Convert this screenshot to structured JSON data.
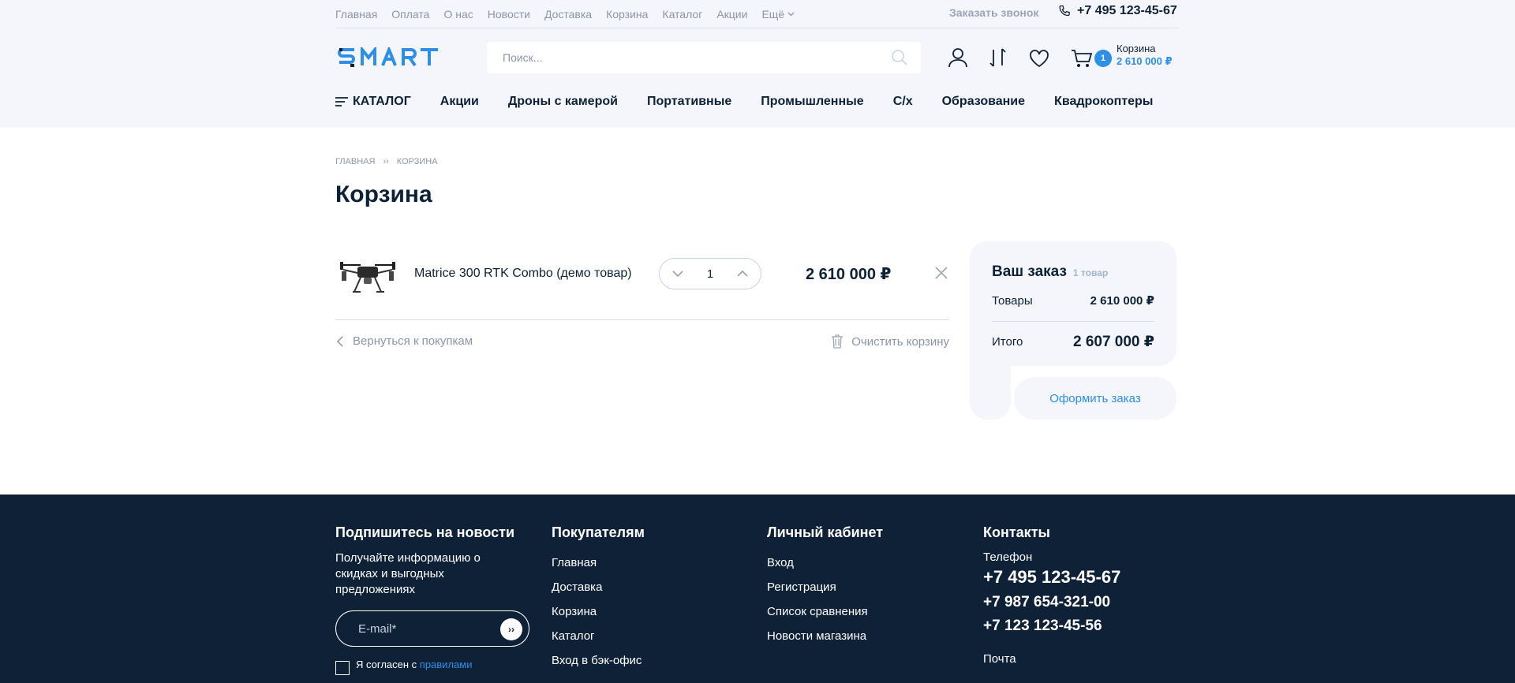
{
  "topbar": {
    "nav": [
      "Главная",
      "Оплата",
      "О нас",
      "Новости",
      "Доставка",
      "Корзина",
      "Каталог",
      "Акции"
    ],
    "more": "Ещё",
    "callback": "Заказать звонок",
    "phone": "+7 495 123-45-67"
  },
  "header": {
    "logo": "SMART",
    "search_placeholder": "Поиск...",
    "cart": {
      "badge": "1",
      "label": "Корзина",
      "sum": "2 610 000 ₽"
    }
  },
  "catnav": {
    "catalog": "КАТАЛОГ",
    "items": [
      "Акции",
      "Дроны с камерой",
      "Портативные",
      "Промышленные",
      "С/х",
      "Образование",
      "Квадрокоптеры"
    ]
  },
  "breadcrumb": [
    "ГЛАВНАЯ",
    "КОРЗИНА"
  ],
  "breadcrumb_sep": "››",
  "page_title": "Корзина",
  "cart_item": {
    "name": "Matrice 300 RTK Combo (демо товар)",
    "qty": "1",
    "price": "2 610 000 ₽"
  },
  "actions": {
    "back": "Вернуться к покупкам",
    "clear": "Очистить корзину"
  },
  "order": {
    "title": "Ваш заказ",
    "count": "1 товар",
    "goods_label": "Товары",
    "goods_value": "2 610 000 ₽",
    "total_label": "Итого",
    "total_value": "2 607 000 ₽",
    "checkout": "Оформить заказ"
  },
  "footer": {
    "subscribe": {
      "title": "Подпишитесь на новости",
      "desc": "Получайте информацию о скидках и выгодных предложениях",
      "email_placeholder": "E-mail*",
      "send": "››",
      "agree_text": "Я согласен с ",
      "agree_link": "правилами"
    },
    "buyers": {
      "title": "Покупателям",
      "links": [
        "Главная",
        "Доставка",
        "Корзина",
        "Каталог",
        "Вход в бэк-офис"
      ]
    },
    "account": {
      "title": "Личный кабинет",
      "links": [
        "Вход",
        "Регистрация",
        "Список сравнения",
        "Новости магазина"
      ]
    },
    "contacts": {
      "title": "Контакты",
      "phone_label": "Телефон",
      "phone_main": "+7 495 123-45-67",
      "phone_2": "+7 987 654-321-00",
      "phone_3": "+7 123 123-45-56",
      "mail_label": "Почта"
    }
  },
  "colors": {
    "accent": "#2d8fe8",
    "dark": "#0f2137",
    "muted": "#8a96a8",
    "band": "#f4f6fb"
  }
}
